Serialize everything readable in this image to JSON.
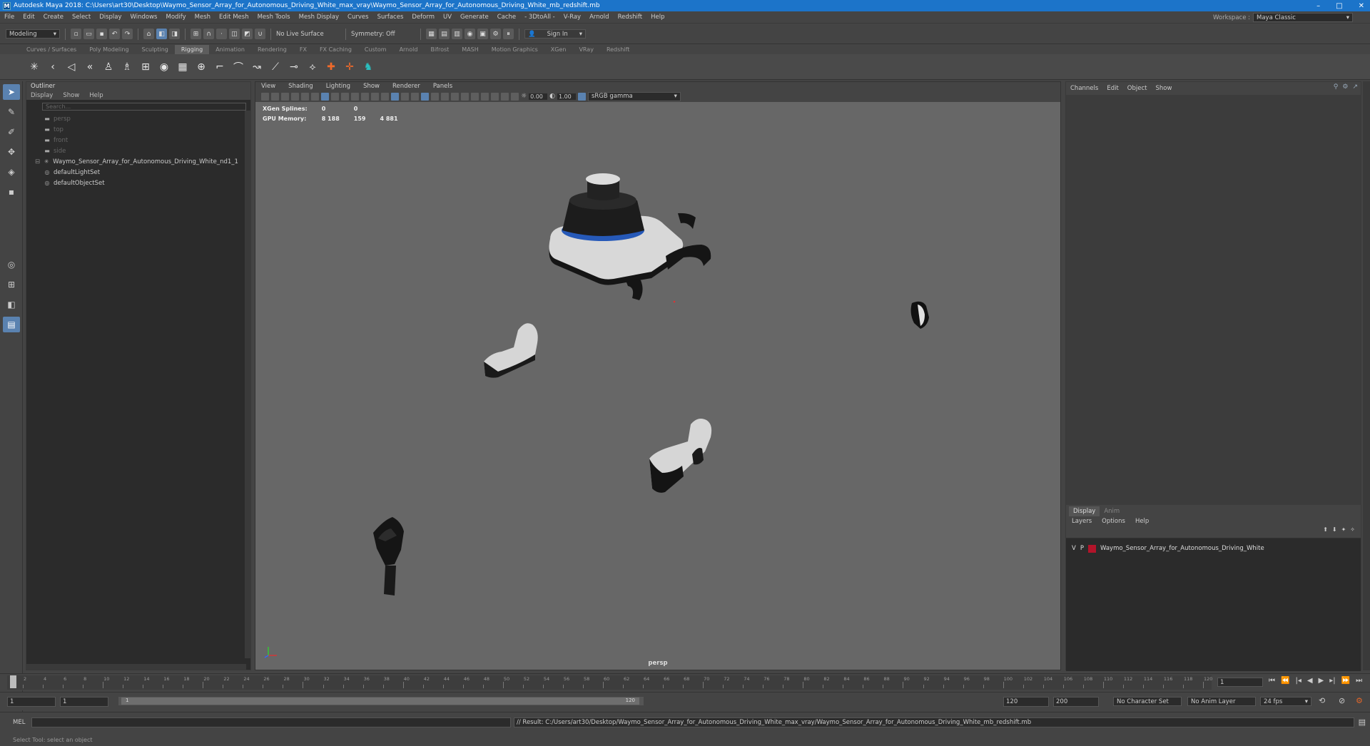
{
  "titlebar": {
    "app_icon": "M",
    "title": "Autodesk Maya 2018: C:\\Users\\art30\\Desktop\\Waymo_Sensor_Array_for_Autonomous_Driving_White_max_vray\\Waymo_Sensor_Array_for_Autonomous_Driving_White_mb_redshift.mb",
    "minimize": "–",
    "maximize": "□",
    "close": "✕"
  },
  "menubar": {
    "items": [
      "File",
      "Edit",
      "Create",
      "Select",
      "Display",
      "Windows",
      "Modify",
      "Mesh",
      "Edit Mesh",
      "Mesh Tools",
      "Mesh Display",
      "Curves",
      "Surfaces",
      "Deform",
      "UV",
      "Generate",
      "Cache",
      "- 3DtoAll -",
      "V-Ray",
      "Arnold",
      "Redshift",
      "Help"
    ],
    "workspace_label": "Workspace :",
    "workspace_value": "Maya Classic"
  },
  "statusline": {
    "mode": "Modeling",
    "live_surface": "No Live Surface",
    "symmetry": "Symmetry: Off",
    "sign_in": "Sign In"
  },
  "shelf": {
    "tabs": [
      "Curves / Surfaces",
      "Poly Modeling",
      "Sculpting",
      "Rigging",
      "Animation",
      "Rendering",
      "FX",
      "FX Caching",
      "Custom",
      "Arnold",
      "Bifrost",
      "MASH",
      "Motion Graphics",
      "XGen",
      "VRay",
      "Redshift"
    ],
    "active_tab": "Rigging"
  },
  "outliner": {
    "title": "Outliner",
    "menu": [
      "Display",
      "Show",
      "Help"
    ],
    "search_placeholder": "Search...",
    "items": [
      {
        "label": "persp",
        "icon": "camera-icon",
        "dim": true,
        "indent": 1
      },
      {
        "label": "top",
        "icon": "camera-icon",
        "dim": true,
        "indent": 1
      },
      {
        "label": "front",
        "icon": "camera-icon",
        "dim": true,
        "indent": 1
      },
      {
        "label": "side",
        "icon": "camera-icon",
        "dim": true,
        "indent": 1
      },
      {
        "label": "Waymo_Sensor_Array_for_Autonomous_Driving_White_nd1_1",
        "icon": "transform-icon",
        "dim": false,
        "indent": 0,
        "expandable": true
      },
      {
        "label": "defaultLightSet",
        "icon": "set-icon",
        "dim": false,
        "indent": 1
      },
      {
        "label": "defaultObjectSet",
        "icon": "set-icon",
        "dim": false,
        "indent": 1
      }
    ]
  },
  "viewport": {
    "menu": [
      "View",
      "Shading",
      "Lighting",
      "Show",
      "Renderer",
      "Panels"
    ],
    "exposure": "0.00",
    "gamma": "1.00",
    "color_space": "sRGB gamma",
    "hud": [
      {
        "label": "XGen Splines:",
        "v1": "0",
        "v2": "0",
        "v3": ""
      },
      {
        "label": "GPU Memory:",
        "v1": "8 188",
        "v2": "159",
        "v3": "4 881"
      }
    ],
    "camera": "persp"
  },
  "channelbox": {
    "menu": [
      "Channels",
      "Edit",
      "Object",
      "Show"
    ],
    "layer_tabs": [
      "Display",
      "Anim"
    ],
    "layer_menu": [
      "Layers",
      "Options",
      "Help"
    ],
    "layers": [
      {
        "v": "V",
        "p": "P",
        "color": "#b2142a",
        "name": "Waymo_Sensor_Array_for_Autonomous_Driving_White"
      }
    ]
  },
  "timeline": {
    "ticks": [
      "1",
      "2",
      "4",
      "6",
      "8",
      "10",
      "12",
      "14",
      "16",
      "18",
      "20",
      "22",
      "24",
      "26",
      "28",
      "30",
      "32",
      "34",
      "36",
      "38",
      "40",
      "42",
      "44",
      "46",
      "48",
      "50",
      "52",
      "54",
      "56",
      "58",
      "60",
      "62",
      "64",
      "66",
      "68",
      "70",
      "72",
      "74",
      "76",
      "78",
      "80",
      "82",
      "84",
      "86",
      "88",
      "90",
      "92",
      "94",
      "96",
      "98",
      "100",
      "102",
      "104",
      "106",
      "108",
      "110",
      "112",
      "114",
      "116",
      "118",
      "120"
    ],
    "current_frame": "1",
    "playhead_frame": 1,
    "range_start": "1",
    "range_start2": "1",
    "range_inner_start": "1",
    "range_inner_end": "120",
    "range_end": "120",
    "range_end2": "200",
    "character_set": "No Character Set",
    "anim_layer": "No Anim Layer",
    "fps": "24 fps"
  },
  "cmdline": {
    "label": "MEL",
    "result": "// Result: C:/Users/art30/Desktop/Waymo_Sensor_Array_for_Autonomous_Driving_White_max_vray/Waymo_Sensor_Array_for_Autonomous_Driving_White_mb_redshift.mb"
  },
  "helpline": {
    "text": "Select Tool: select an object"
  }
}
